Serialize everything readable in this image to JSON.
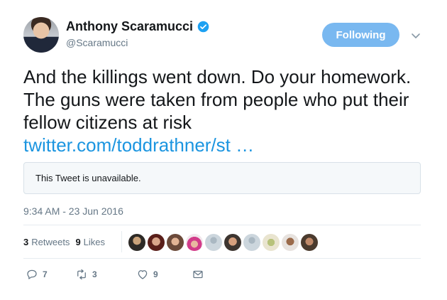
{
  "author": {
    "name": "Anthony Scaramucci",
    "handle": "@Scaramucci"
  },
  "follow_button": {
    "label": "Following"
  },
  "tweet": {
    "text": "And the killings went down. Do your homework. The guns were taken from people who put their fellow citizens at risk",
    "link": "twitter.com/toddrathner/st …"
  },
  "quoted": {
    "message": "This Tweet is unavailable."
  },
  "timestamp": "9:34 AM - 23 Jun 2016",
  "stats": {
    "retweets_count": "3",
    "retweets_label": "Retweets",
    "likes_count": "9",
    "likes_label": "Likes"
  },
  "actions": {
    "reply_count": "7",
    "retweet_count": "3",
    "like_count": "9"
  },
  "colors": {
    "link": "#1b95e0",
    "follow_button": "#79b8f0",
    "verified": "#1da1f2",
    "muted": "#657786"
  },
  "icons": [
    "verified-badge-icon",
    "chevron-down-icon",
    "reply-icon",
    "retweet-icon",
    "like-icon",
    "direct-message-icon"
  ]
}
